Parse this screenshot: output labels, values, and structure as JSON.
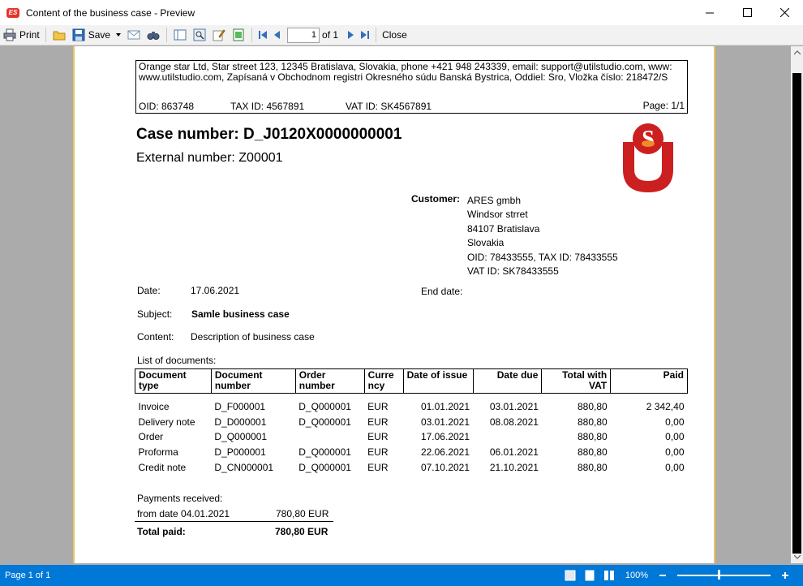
{
  "window": {
    "app_icon_text": "ES",
    "title": "Content of the business case - Preview"
  },
  "toolbar": {
    "print_label": "Print",
    "save_label": "Save",
    "page_value": "1",
    "page_of": "of 1",
    "close_label": "Close"
  },
  "report": {
    "company_line": "Orange star Ltd, Star street 123, 12345 Bratislava, Slovakia, phone +421 948 243339, email: support@utilstudio.com, www: www.utilstudio.com, Zapísaná v Obchodnom registri Okresného súdu Banská Bystrica, Oddiel: Sro, Vložka číslo: 218472/S",
    "oid": "OID: 863748",
    "tax_id": "TAX ID: 4567891",
    "vat_id": "VAT ID: SK4567891",
    "page": "Page: 1/1",
    "case_number": "Case number: D_J0120X0000000001",
    "external_number": "External number: Z00001",
    "logo_letter": "S",
    "customer_label": "Customer:",
    "customer": {
      "name": "ARES gmbh",
      "street": "Windsor strret",
      "city": "84107 Bratislava",
      "country": "Slovakia",
      "ids": "OID: 78433555, TAX ID: 78433555",
      "vat": "VAT ID: SK78433555"
    },
    "date_label": "Date:",
    "date_value": "17.06.2021",
    "end_date_label": "End date:",
    "subject_label": "Subject:",
    "subject_value": "Samle business case",
    "content_label": "Content:",
    "content_value": "Description of business case",
    "list_label": "List of documents:",
    "columns": {
      "doc_type_1": "Document",
      "doc_type_2": "type",
      "doc_num_1": "Document",
      "doc_num_2": "number",
      "order_num_1": "Order",
      "order_num_2": "number",
      "currency_1": "Curre",
      "currency_2": "ncy",
      "date_issue": "Date of issue",
      "date_due": "Date due",
      "total_vat_1": "Total with",
      "total_vat_2": "VAT",
      "paid": "Paid"
    },
    "documents": [
      {
        "type": "Invoice",
        "number": "D_F000001",
        "order": "D_Q000001",
        "currency": "EUR",
        "issue": "01.01.2021",
        "due": "03.01.2021",
        "total": "880,80",
        "paid": "2 342,40"
      },
      {
        "type": "Delivery note",
        "number": "D_D000001",
        "order": "D_Q000001",
        "currency": "EUR",
        "issue": "03.01.2021",
        "due": "08.08.2021",
        "total": "880,80",
        "paid": "0,00"
      },
      {
        "type": "Order",
        "number": "D_Q000001",
        "order": "",
        "currency": "EUR",
        "issue": "17.06.2021",
        "due": "",
        "total": "880,80",
        "paid": "0,00"
      },
      {
        "type": "Proforma",
        "number": "D_P000001",
        "order": "D_Q000001",
        "currency": "EUR",
        "issue": "22.06.2021",
        "due": "06.01.2021",
        "total": "880,80",
        "paid": "0,00"
      },
      {
        "type": "Credit note",
        "number": "D_CN000001",
        "order": "D_Q000001",
        "currency": "EUR",
        "issue": "07.10.2021",
        "due": "21.10.2021",
        "total": "880,80",
        "paid": "0,00"
      }
    ],
    "payments_label": "Payments received:",
    "payment_from": "from date 04.01.2021",
    "payment_amount": "780,80 EUR",
    "total_paid_label": "Total paid:",
    "total_paid_value": "780,80 EUR"
  },
  "statusbar": {
    "page_info": "Page 1 of 1",
    "zoom": "100%",
    "zoom_level_fraction": 0.45
  },
  "colors": {
    "statusbar": "#0078d7",
    "logo_red": "#cc1f1f",
    "logo_orange": "#f08a24"
  }
}
